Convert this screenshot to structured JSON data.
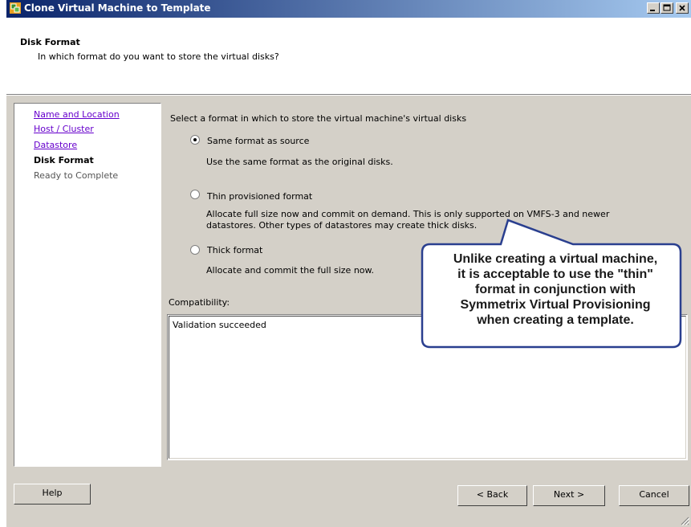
{
  "window": {
    "title": "Clone Virtual Machine to Template"
  },
  "header": {
    "title": "Disk Format",
    "subtitle": "In which format do you want to store the virtual disks?"
  },
  "nav": {
    "items": [
      {
        "label": "Name and Location",
        "state": "link"
      },
      {
        "label": "Host / Cluster",
        "state": "link"
      },
      {
        "label": "Datastore",
        "state": "link"
      },
      {
        "label": "Disk Format",
        "state": "current"
      },
      {
        "label": "Ready to Complete",
        "state": "future"
      }
    ]
  },
  "main": {
    "instruction": "Select a format in which to store the virtual machine's virtual disks",
    "options": [
      {
        "label": "Same format as source",
        "selected": true,
        "description": [
          "Use the same format as the original disks."
        ]
      },
      {
        "label": "Thin provisioned format",
        "selected": false,
        "description": [
          "Allocate full size now and commit on demand. This is only supported on VMFS-3 and newer",
          "datastores. Other types of datastores may create thick disks."
        ]
      },
      {
        "label": "Thick format",
        "selected": false,
        "description": [
          "Allocate and commit the full size now."
        ]
      }
    ],
    "compatibility_label": "Compatibility:",
    "compatibility_text": "Validation succeeded"
  },
  "callout": {
    "lines": [
      "Unlike creating a virtual machine,",
      "it is acceptable to use the \"thin\"",
      "format in conjunction with",
      "Symmetrix Virtual Provisioning",
      "when creating a template."
    ],
    "border_color": "#2a3f8f"
  },
  "footer": {
    "help_label": "Help",
    "help_mnemonic": "H",
    "back_label": "< Back",
    "back_mnemonic": "<",
    "next_label": "Next >",
    "next_mnemonic": ">",
    "cancel_label": "Cancel"
  },
  "colors": {
    "title_start": "#0a246a",
    "title_end": "#a6caf0",
    "link": "#6600cc",
    "dialog_bg": "#d4d0c8"
  }
}
